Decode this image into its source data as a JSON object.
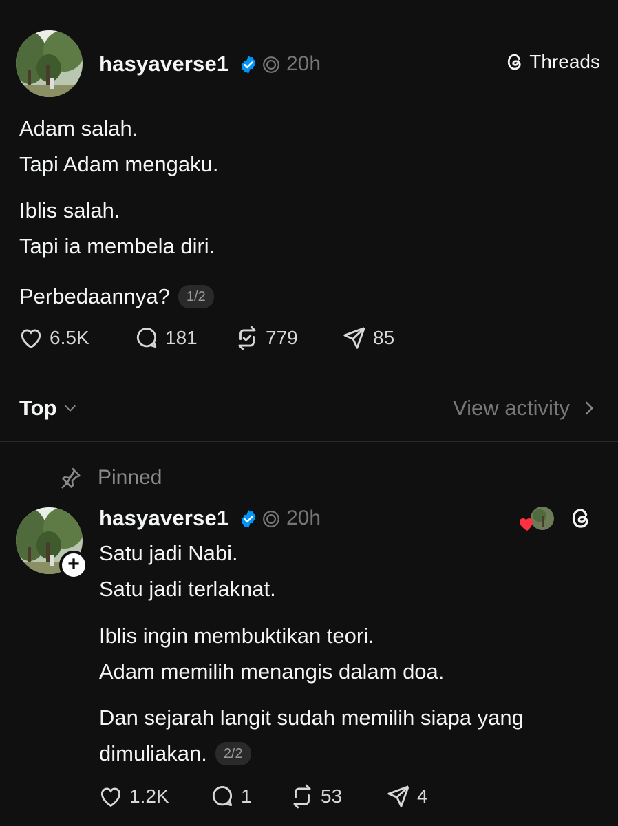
{
  "post": {
    "username": "hasyaverse1",
    "time": "20h",
    "brand_label": "Threads",
    "paragraphs": [
      {
        "lines": [
          "Adam salah.",
          "Tapi Adam mengaku."
        ]
      },
      {
        "lines": [
          "Iblis salah.",
          "Tapi ia membela diri."
        ]
      },
      {
        "lines": [
          "Perbedaannya?"
        ],
        "pager": "1/2"
      }
    ],
    "stats": {
      "likes": "6.5K",
      "replies": "181",
      "reposts": "779",
      "shares": "85"
    }
  },
  "sort_bar": {
    "label": "Top",
    "view_activity": "View activity"
  },
  "reply": {
    "pinned_label": "Pinned",
    "username": "hasyaverse1",
    "time": "20h",
    "paragraphs": [
      {
        "lines": [
          "Satu jadi Nabi.",
          "Satu jadi terlaknat."
        ]
      },
      {
        "lines": [
          "Iblis ingin membuktikan teori.",
          "Adam memilih menangis dalam doa."
        ]
      },
      {
        "lines": [
          "Dan sejarah langit sudah memilih siapa yang",
          "dimuliakan."
        ],
        "pager": "2/2"
      }
    ],
    "stats": {
      "likes": "1.2K",
      "replies": "1",
      "reposts": "53",
      "shares": "4"
    }
  },
  "icons": {
    "verified": "verified-badge-icon",
    "threads": "threads-logo-icon",
    "like": "heart-icon",
    "reply": "comment-bubble-icon",
    "repost": "repost-icon",
    "share": "send-icon",
    "pin": "pin-icon"
  },
  "colors": {
    "background": "#101010",
    "verified_blue": "#0095f6",
    "like_red": "#ff3040"
  }
}
